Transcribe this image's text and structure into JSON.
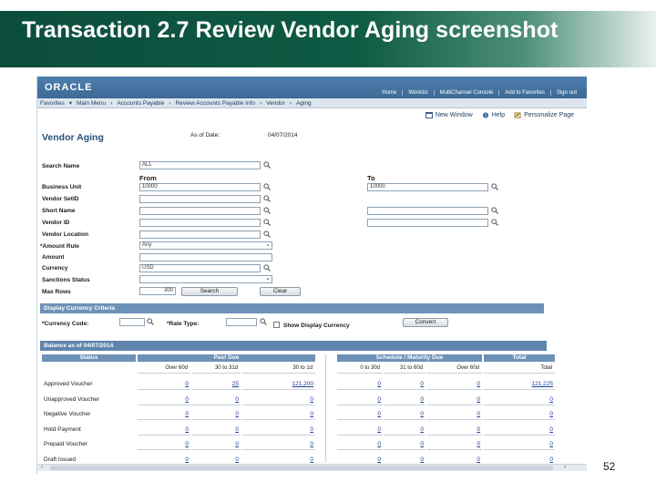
{
  "slide": {
    "title": "Transaction 2.7 Review Vendor Aging screenshot",
    "page_number": "52"
  },
  "header": {
    "logo": "ORACLE",
    "top_links": [
      "Home",
      "Worklist",
      "MultiChannel Console",
      "Add to Favorites",
      "Sign out"
    ]
  },
  "breadcrumb": [
    "Favorites",
    "Main Menu",
    "Accounts Payable",
    "Review Accounts Payable Info",
    "Vendor",
    "Aging"
  ],
  "utility_links": {
    "new_window": "New Window",
    "help": "Help",
    "personalize": "Personalize Page"
  },
  "page": {
    "title": "Vendor Aging",
    "as_of_label": "As of Date:",
    "as_of_value": "04/07/2014"
  },
  "criteria": {
    "search_name_label": "Search Name",
    "search_name_value": "ALL",
    "from_label": "From",
    "to_label": "To",
    "business_unit_label": "Business Unit",
    "business_unit_from": "10000",
    "business_unit_to": "10000",
    "vendor_setid_label": "Vendor SetID",
    "short_name_label": "Short Name",
    "vendor_id_label": "Vendor ID",
    "vendor_location_label": "Vendor Location",
    "amount_rule_label": "*Amount Rule",
    "amount_rule_value": "Any",
    "amount_label": "Amount",
    "currency_label": "Currency",
    "currency_value": "USD",
    "sanctions_label": "Sanctions Status",
    "max_rows_label": "Max Rows",
    "max_rows_value": "300",
    "search_button": "Search",
    "clear_button": "Clear"
  },
  "display_currency": {
    "section_title": "Display Currency Criteria",
    "currency_code_label": "*Currency Code:",
    "rate_type_label": "*Rate Type:",
    "show_display_label": "Show Display Currency",
    "convert_button": "Convert"
  },
  "balance": {
    "section_title": "Balance as of 04/07/2014",
    "group_headers": {
      "status": "Status",
      "past_due": "Past Due",
      "schedule": "Schedule / Maturity Due",
      "total": "Total"
    },
    "sub_headers": [
      "Over 60d",
      "30 to 31d",
      "30 to 1d",
      "0 to 30d",
      "31 to 60d",
      "Over 60d",
      "Total"
    ],
    "rows": [
      {
        "status": "Approved Voucher",
        "values": [
          "0",
          "25",
          "121,200",
          "0",
          "0",
          "0",
          "121,225"
        ]
      },
      {
        "status": "Unapproved Voucher",
        "values": [
          "0",
          "0",
          "0",
          "0",
          "0",
          "0",
          "0"
        ]
      },
      {
        "status": "Negative Voucher",
        "values": [
          "0",
          "0",
          "0",
          "0",
          "0",
          "0",
          "0"
        ]
      },
      {
        "status": "Hold Payment",
        "values": [
          "0",
          "0",
          "0",
          "0",
          "0",
          "0",
          "0"
        ]
      },
      {
        "status": "Prepaid Voucher",
        "values": [
          "0",
          "0",
          "0",
          "0",
          "0",
          "0",
          "0"
        ]
      },
      {
        "status": "Draft Issued",
        "values": [
          "0",
          "0",
          "0",
          "0",
          "0",
          "0",
          "0"
        ]
      }
    ]
  },
  "colors": {
    "title_bar": "#0f5b44",
    "ps_header": "#4f7fae",
    "section_bar": "#6d91b7",
    "link": "#1d3f9a"
  }
}
